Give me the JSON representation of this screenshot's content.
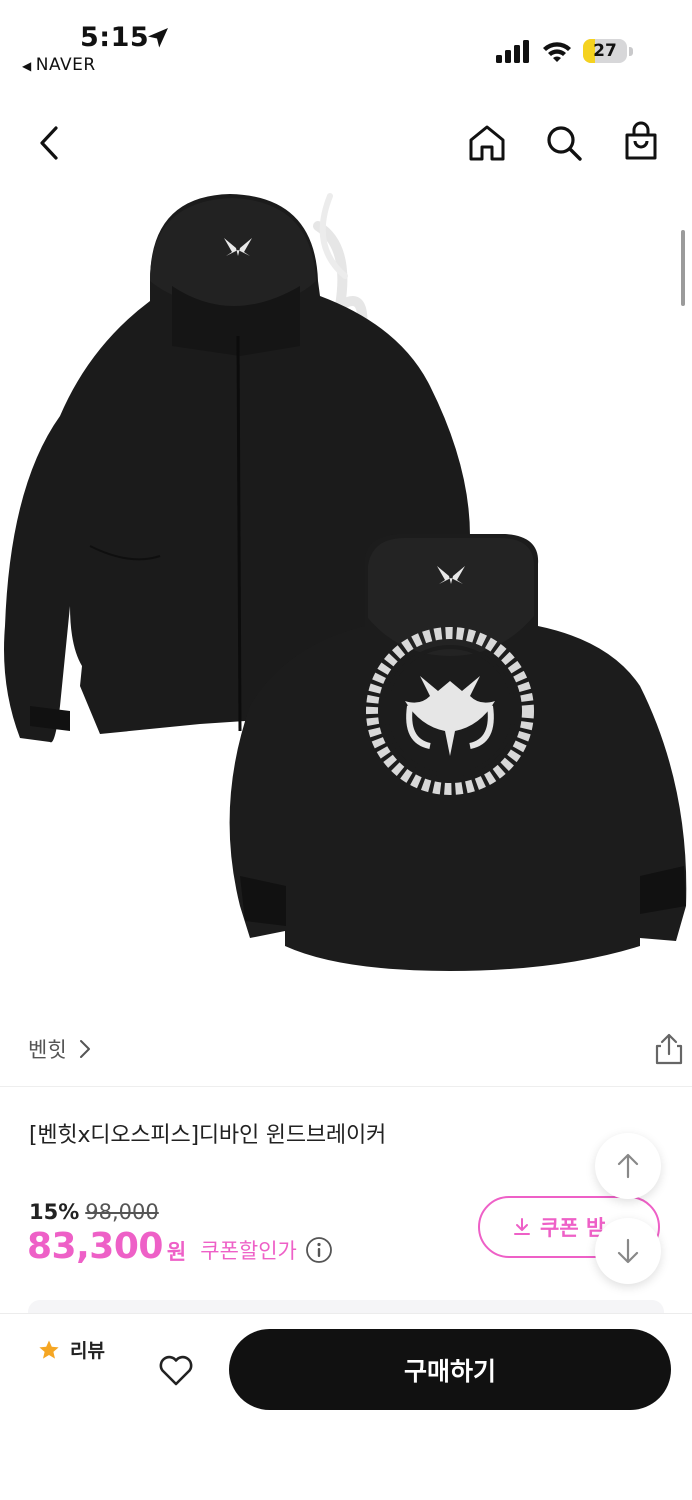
{
  "status_bar": {
    "time": "5:15",
    "back_app": "NAVER",
    "battery_level": "27",
    "battery_fraction": 0.27
  },
  "nav": {
    "icons": [
      "back-icon",
      "home-icon",
      "search-icon",
      "shopping-bag-icon"
    ]
  },
  "product": {
    "brand": "벤힛",
    "title": "[벤힛x디오스피스]디바인 윈드브레이커",
    "discount_rate": "15%",
    "original_price": "98,000",
    "sale_price": "83,300",
    "currency_unit": "원",
    "coupon_price_label": "쿠폰할인가"
  },
  "coupon": {
    "button_label": "쿠폰 받"
  },
  "bottom_bar": {
    "review_label": "리뷰",
    "buy_label": "구매하기"
  },
  "colors": {
    "accent": "#ee60c7",
    "buy_button": "#111111",
    "star": "#f5a623",
    "battery": "#f5d21f"
  }
}
